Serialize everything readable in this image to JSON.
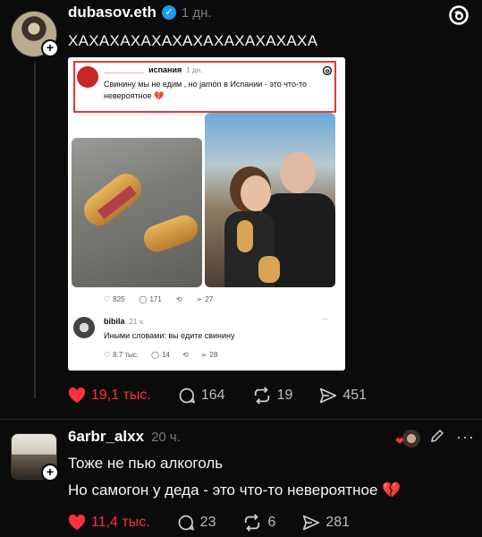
{
  "post": {
    "username": "dubasov.eth",
    "time": "1 дн.",
    "text": "ХАХАХАХАХАХАХАХАХАХАХАХА",
    "likes": "19,1 тыс.",
    "comments": "164",
    "reposts": "19",
    "shares": "451"
  },
  "embed": {
    "header_username": "_________",
    "header_country": "испания",
    "header_time": "1 дн.",
    "text": "Свинину мы не едим , но jamón в Испании - это что-то невероятное 💔",
    "stats": {
      "likes": "825",
      "comments": "171",
      "shares": "27"
    },
    "reply": {
      "username": "bibila",
      "time": "21 ч.",
      "text": "Иными словами: вы едите свинину",
      "likes": "8.7 тыс.",
      "comments": "14",
      "shares": "28"
    }
  },
  "comment": {
    "username": "6arbr_alxx",
    "time": "20 ч.",
    "line1": "Тоже не пью алкоголь",
    "line2": "Но самогон у деда - это что-то невероятное 💔",
    "likes": "11,4 тыс.",
    "comments": "23",
    "reposts": "6",
    "shares": "281"
  },
  "colors": {
    "like": "#ff3040",
    "background": "#0b0b0b",
    "verified": "#1d9bf0"
  }
}
